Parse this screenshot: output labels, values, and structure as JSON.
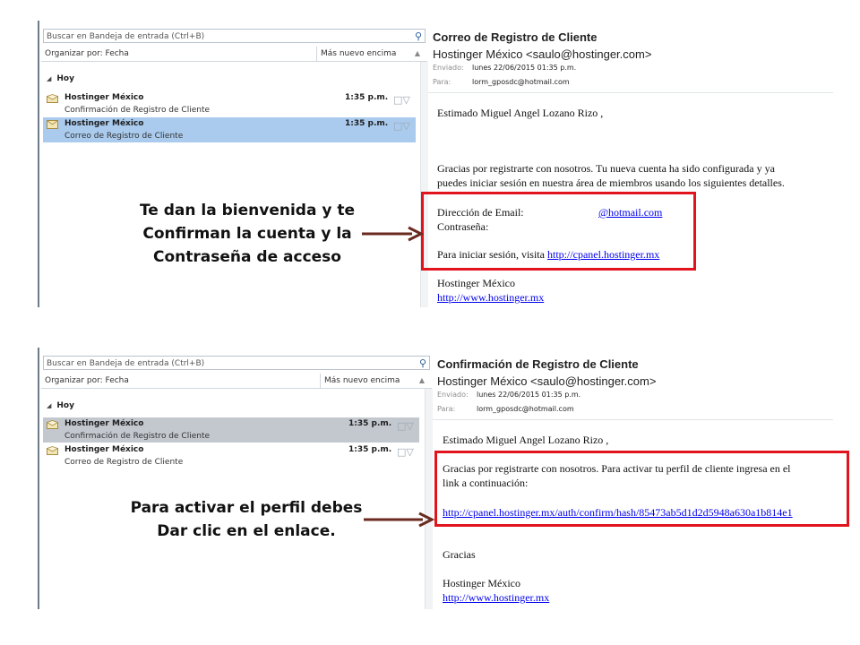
{
  "colors": {
    "highlight_box": "#e1141e",
    "arrow": "#6b2a1f",
    "selected_row": "#aacbee",
    "selected_row_inactive": "#c3c8cf",
    "link": "#0000ee"
  },
  "panel1": {
    "search_placeholder": "Buscar en Bandeja de entrada (Ctrl+B)",
    "sort_label": "Organizar por: Fecha",
    "sort_order": "Más nuevo encima",
    "group": "Hoy",
    "emails": [
      {
        "from": "Hostinger México",
        "subject": "Confirmación de Registro de Cliente",
        "time": "1:35 p.m.",
        "selected": false
      },
      {
        "from": "Hostinger México",
        "subject": "Correo de Registro de Cliente",
        "time": "1:35 p.m.",
        "selected": true
      }
    ],
    "reader": {
      "subject": "Correo de Registro de Cliente",
      "sender": "Hostinger México <saulo@hostinger.com>",
      "sent_label": "Enviado:",
      "sent_value": "lunes 22/06/2015 01:35 p.m.",
      "to_label": "Para:",
      "to_value": "lorm_gposdc@hotmail.com",
      "greeting": "Estimado Miguel Angel Lozano Rizo ,",
      "intro_line1": "Gracias por registrarte con nosotros. Tu nueva cuenta ha sido configurada y ya",
      "intro_line2": "puedes iniciar sesión en nuestra área de miembros usando los siguientes detalles.",
      "email_label": "Dirección de Email:",
      "email_value": "@hotmail.com",
      "password_label": "Contraseña:",
      "login_text": "Para iniciar sesión, visita",
      "login_link": "http://cpanel.hostinger.mx",
      "signature": "Hostinger México",
      "signature_link": "http://www.hostinger.mx"
    },
    "caption": [
      "Te dan la bienvenida y te",
      "Confirman la cuenta y la",
      "Contraseña de acceso"
    ]
  },
  "panel2": {
    "search_placeholder": "Buscar en Bandeja de entrada (Ctrl+B)",
    "sort_label": "Organizar por: Fecha",
    "sort_order": "Más nuevo encima",
    "group": "Hoy",
    "emails": [
      {
        "from": "Hostinger México",
        "subject": "Confirmación de Registro de Cliente",
        "time": "1:35 p.m.",
        "selected": true
      },
      {
        "from": "Hostinger México",
        "subject": "Correo de Registro de Cliente",
        "time": "1:35 p.m.",
        "selected": false
      }
    ],
    "reader": {
      "subject": "Confirmación de Registro de Cliente",
      "sender": "Hostinger México <saulo@hostinger.com>",
      "sent_label": "Enviado:",
      "sent_value": "lunes 22/06/2015 01:35 p.m.",
      "to_label": "Para:",
      "to_value": "lorm_gposdc@hotmail.com",
      "greeting": "Estimado Miguel Angel Lozano Rizo ,",
      "intro_line1": "Gracias por registrarte con nosotros. Para activar tu perfil de cliente ingresa en el",
      "intro_line2": "link a continuación:",
      "activation_link": "http://cpanel.hostinger.mx/auth/confirm/hash/85473ab5d1d2d5948a630a1b814e1",
      "thanks": "Gracias",
      "signature": "Hostinger México",
      "signature_link": "http://www.hostinger.mx"
    },
    "caption": [
      "Para activar el perfil debes",
      "Dar clic en el enlace."
    ]
  }
}
